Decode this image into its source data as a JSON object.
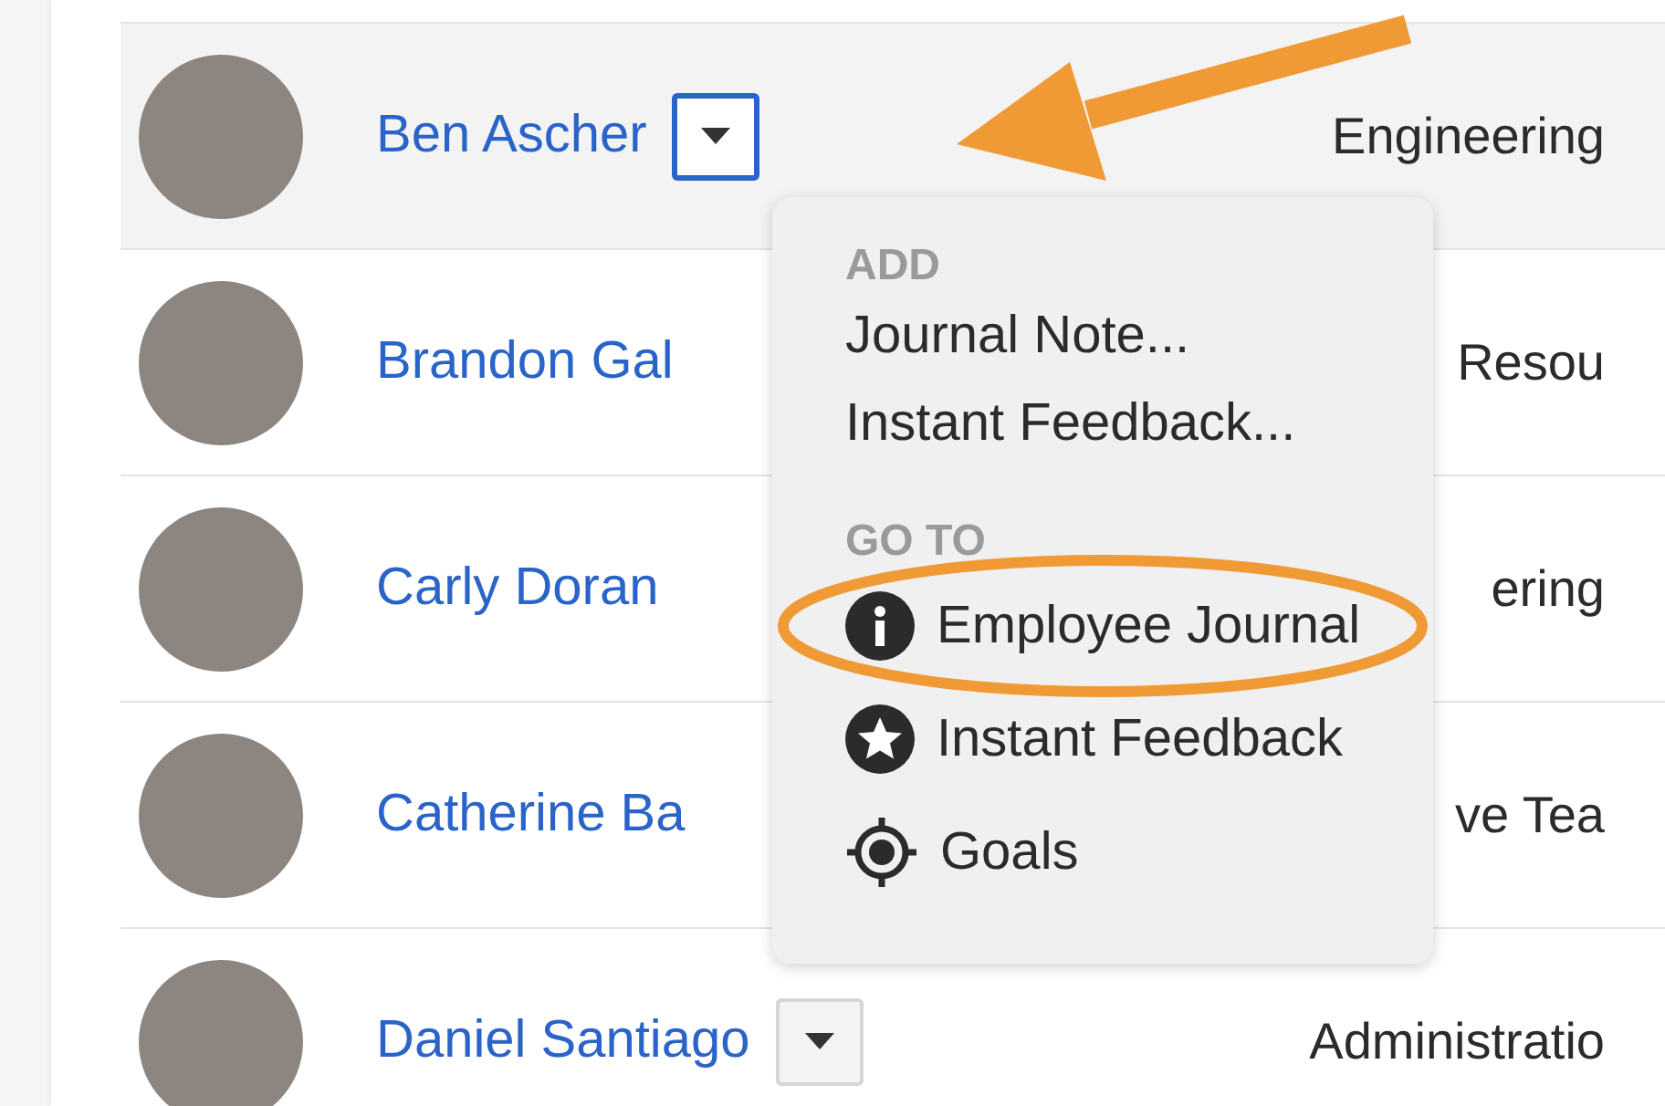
{
  "people": [
    {
      "name": "Ben Ascher",
      "department": "Engineering",
      "selected": true,
      "arrow": true,
      "menu_button": {
        "focused": true
      }
    },
    {
      "name": "Brandon Gal",
      "department": "Resou",
      "selected": false
    },
    {
      "name": "Carly Doran",
      "department": "ering",
      "selected": false
    },
    {
      "name": "Catherine Ba",
      "department": "ve Tea",
      "selected": false
    },
    {
      "name": "Daniel Santiago",
      "department": "Administratio",
      "selected": false,
      "menu_button": {
        "focused": false
      }
    }
  ],
  "menu": {
    "sections": [
      {
        "heading": "ADD",
        "kind": "actions",
        "items": [
          {
            "label": "Journal Note...",
            "circled": false
          },
          {
            "label": "Instant Feedback...",
            "circled": false
          }
        ]
      },
      {
        "heading": "GO TO",
        "kind": "pages",
        "items": [
          {
            "label": "Employee Journal",
            "circled": true
          },
          {
            "label": "Instant Feedback",
            "circled": false
          },
          {
            "label": "Goals",
            "circled": false
          }
        ]
      }
    ]
  }
}
